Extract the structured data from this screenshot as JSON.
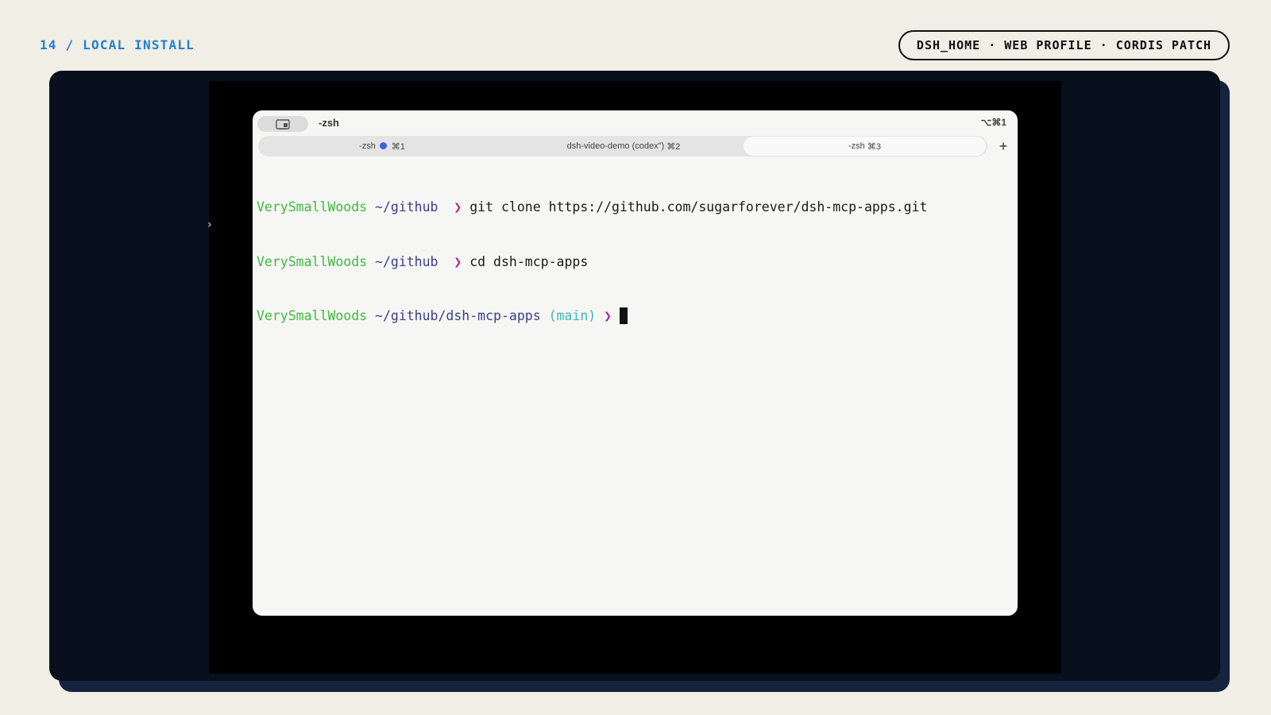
{
  "slide": {
    "label": "14 / LOCAL INSTALL",
    "pill": "DSH_HOME · WEB PROFILE · CORDIS PATCH"
  },
  "terminal": {
    "title": "-zsh",
    "shortcut": "⌥⌘1",
    "tabs": [
      {
        "label": "-zsh",
        "shortcut": "⌘1",
        "has_activity_dot": true
      },
      {
        "label": "dsh-video-demo (codex\")",
        "shortcut": "⌘2"
      },
      {
        "label": "-zsh",
        "shortcut": "⌘3",
        "selected": true
      }
    ],
    "new_tab_label": "+",
    "lines": [
      {
        "host": "VerySmallWoods",
        "path": "~/github",
        "branch": "",
        "prompt": "❯",
        "command": "git clone https://github.com/sugarforever/dsh-mcp-apps.git"
      },
      {
        "host": "VerySmallWoods",
        "path": "~/github",
        "branch": "",
        "prompt": "❯",
        "command": "cd dsh-mcp-apps"
      },
      {
        "host": "VerySmallWoods",
        "path": "~/github/dsh-mcp-apps",
        "branch": "(main)",
        "prompt": "❯",
        "command": ""
      }
    ]
  },
  "icons": {
    "sidebar_toggle": "sidebar-toggle-icon",
    "activity_dot": "activity-dot-icon",
    "new_tab": "plus-icon",
    "mouse_cursor": "mouse-cursor-icon"
  },
  "colors": {
    "page_bg": "#f1eee5",
    "label_blue": "#1f7fd6",
    "frame_bg": "#07101d",
    "host_green": "#3dbb3b",
    "path_navy": "#3b3f86",
    "branch_teal": "#3fb6b7",
    "prompt_magenta": "#b02a86"
  }
}
